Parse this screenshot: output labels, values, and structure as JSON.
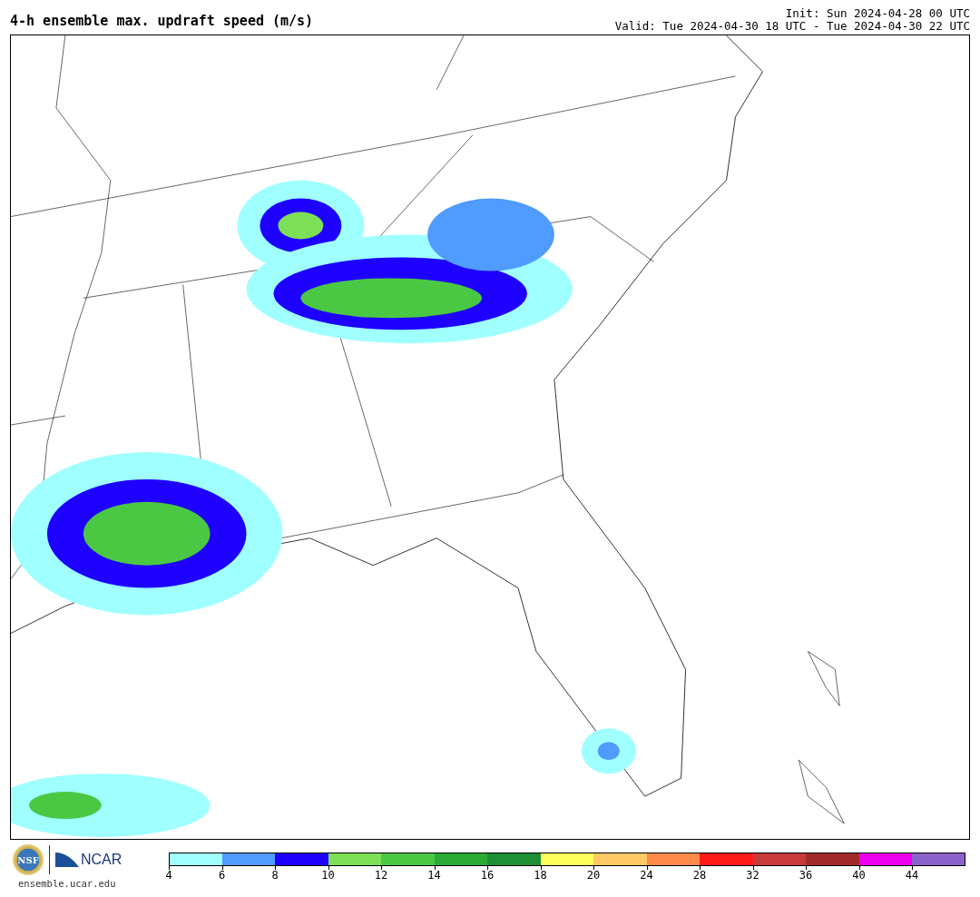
{
  "title": "4-h ensemble max. updraft speed (m/s)",
  "init": "Init: Sun 2024-04-28 00 UTC",
  "valid": "Valid: Tue 2024-04-30 18 UTC - Tue 2024-04-30 22 UTC",
  "logos": {
    "nsf": "NSF",
    "ncar": "NCAR",
    "url": "ensemble.ucar.edu"
  },
  "colorbar": {
    "bins": [
      {
        "color": "#a0ffff"
      },
      {
        "color": "#4f9bff"
      },
      {
        "color": "#1e00ff"
      },
      {
        "color": "#7ddf55"
      },
      {
        "color": "#4bc843"
      },
      {
        "color": "#2bab35"
      },
      {
        "color": "#1d8f36"
      },
      {
        "color": "#ffff5e"
      },
      {
        "color": "#ffc966"
      },
      {
        "color": "#ff8a4a"
      },
      {
        "color": "#ff1a1a"
      },
      {
        "color": "#c93a3a"
      },
      {
        "color": "#a12b2b"
      },
      {
        "color": "#ee00ee"
      },
      {
        "color": "#8a63cc"
      }
    ],
    "ticks": [
      "4",
      "6",
      "8",
      "10",
      "12",
      "14",
      "16",
      "18",
      "20",
      "24",
      "28",
      "32",
      "36",
      "40",
      "44"
    ]
  }
}
